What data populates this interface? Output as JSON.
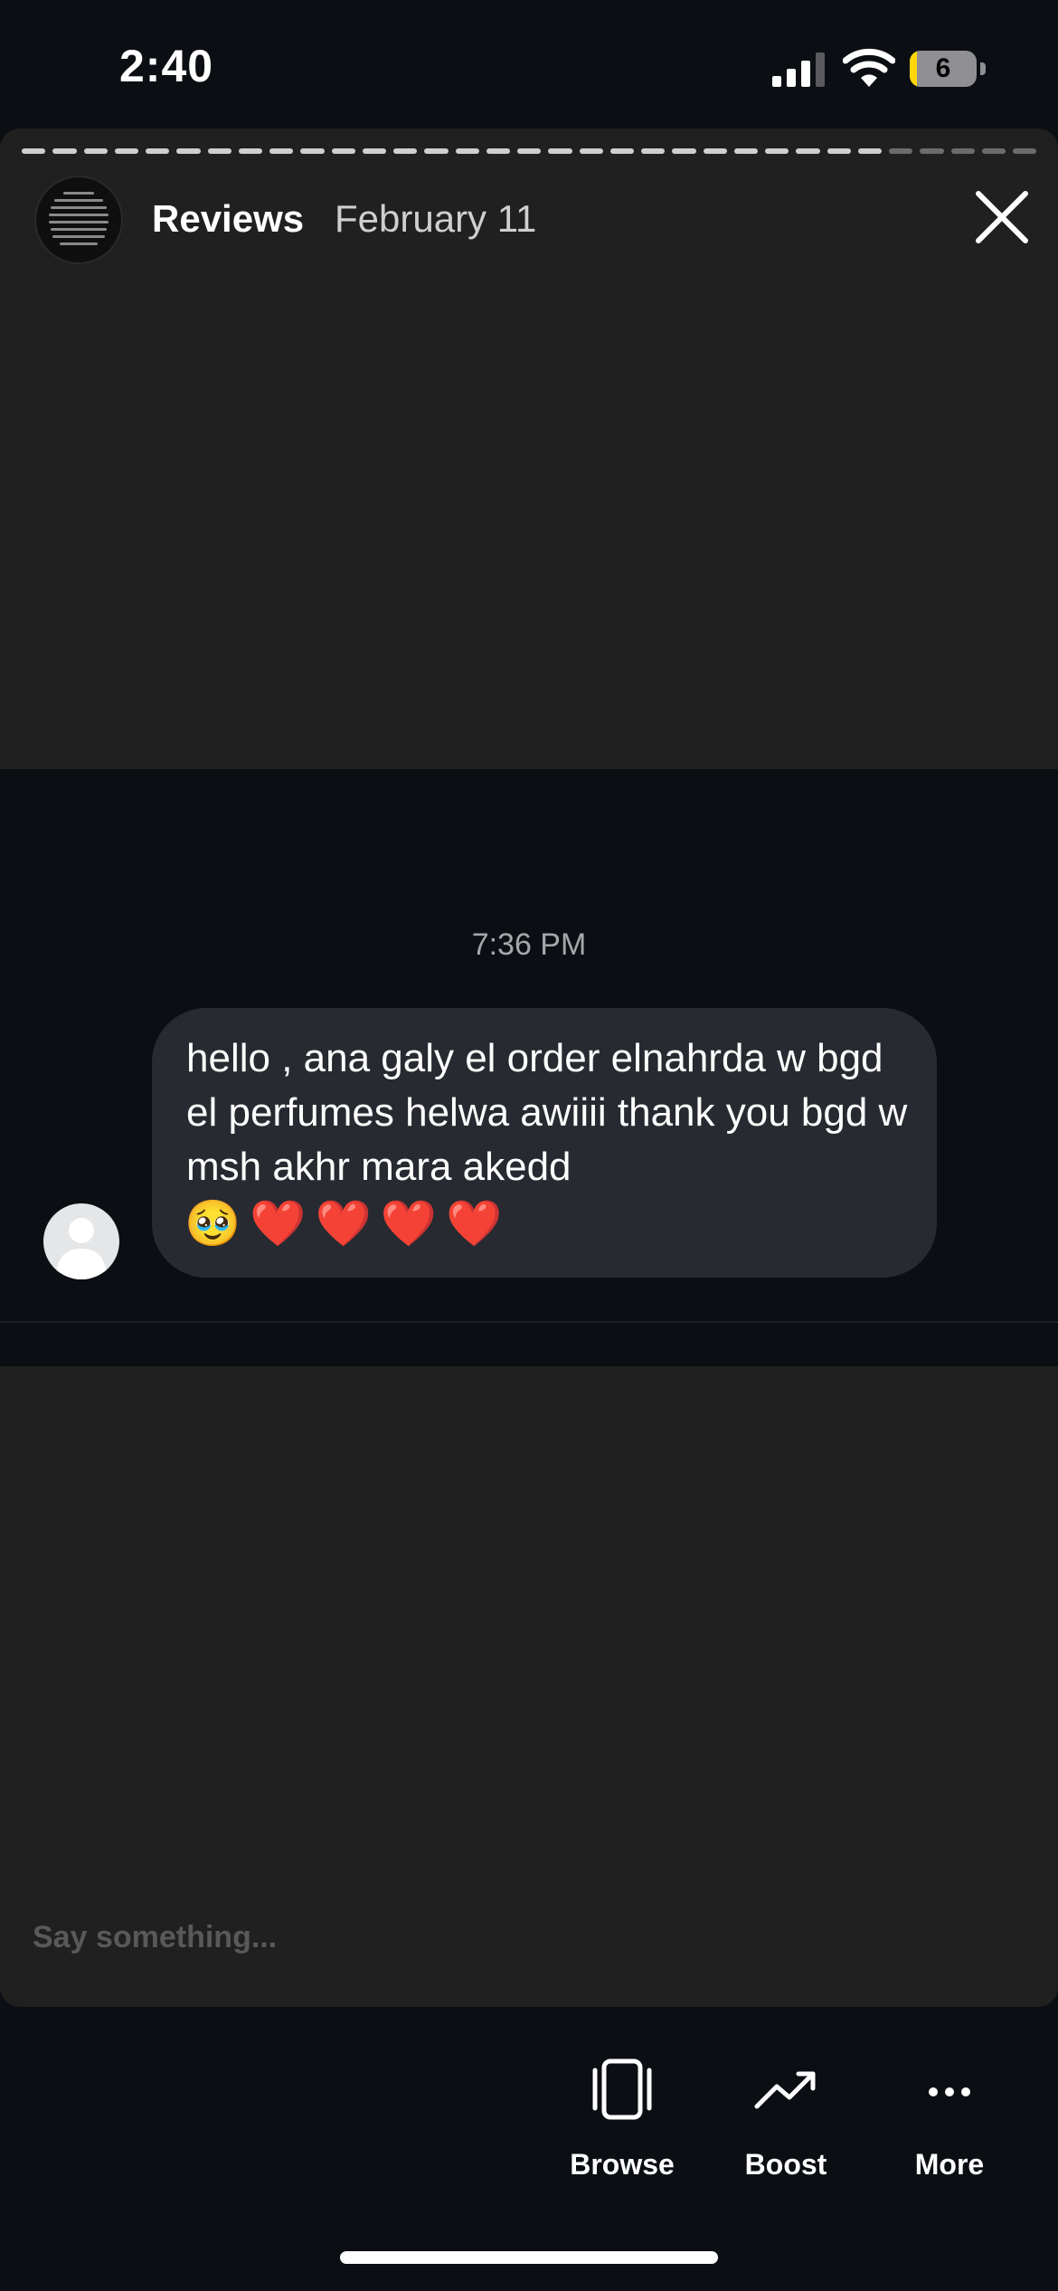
{
  "status_bar": {
    "time": "2:40",
    "battery_level": "6"
  },
  "story": {
    "title": "Reviews",
    "date": "February 11",
    "progress_segments_total": 33,
    "progress_segments_viewed": 28
  },
  "message": {
    "timestamp": "7:36 PM",
    "text": "hello , ana galy el order elnahrda w bgd el perfumes helwa awiiii thank you bgd w msh akhr mara akedd",
    "emojis": [
      "🥹",
      "❤️",
      "❤️",
      "❤️",
      "❤️"
    ]
  },
  "reply_input": {
    "placeholder": "Say something..."
  },
  "actions": [
    {
      "label": "Browse",
      "icon": "browse-icon"
    },
    {
      "label": "Boost",
      "icon": "trending-up-icon"
    },
    {
      "label": "More",
      "icon": "ellipsis-icon"
    }
  ]
}
